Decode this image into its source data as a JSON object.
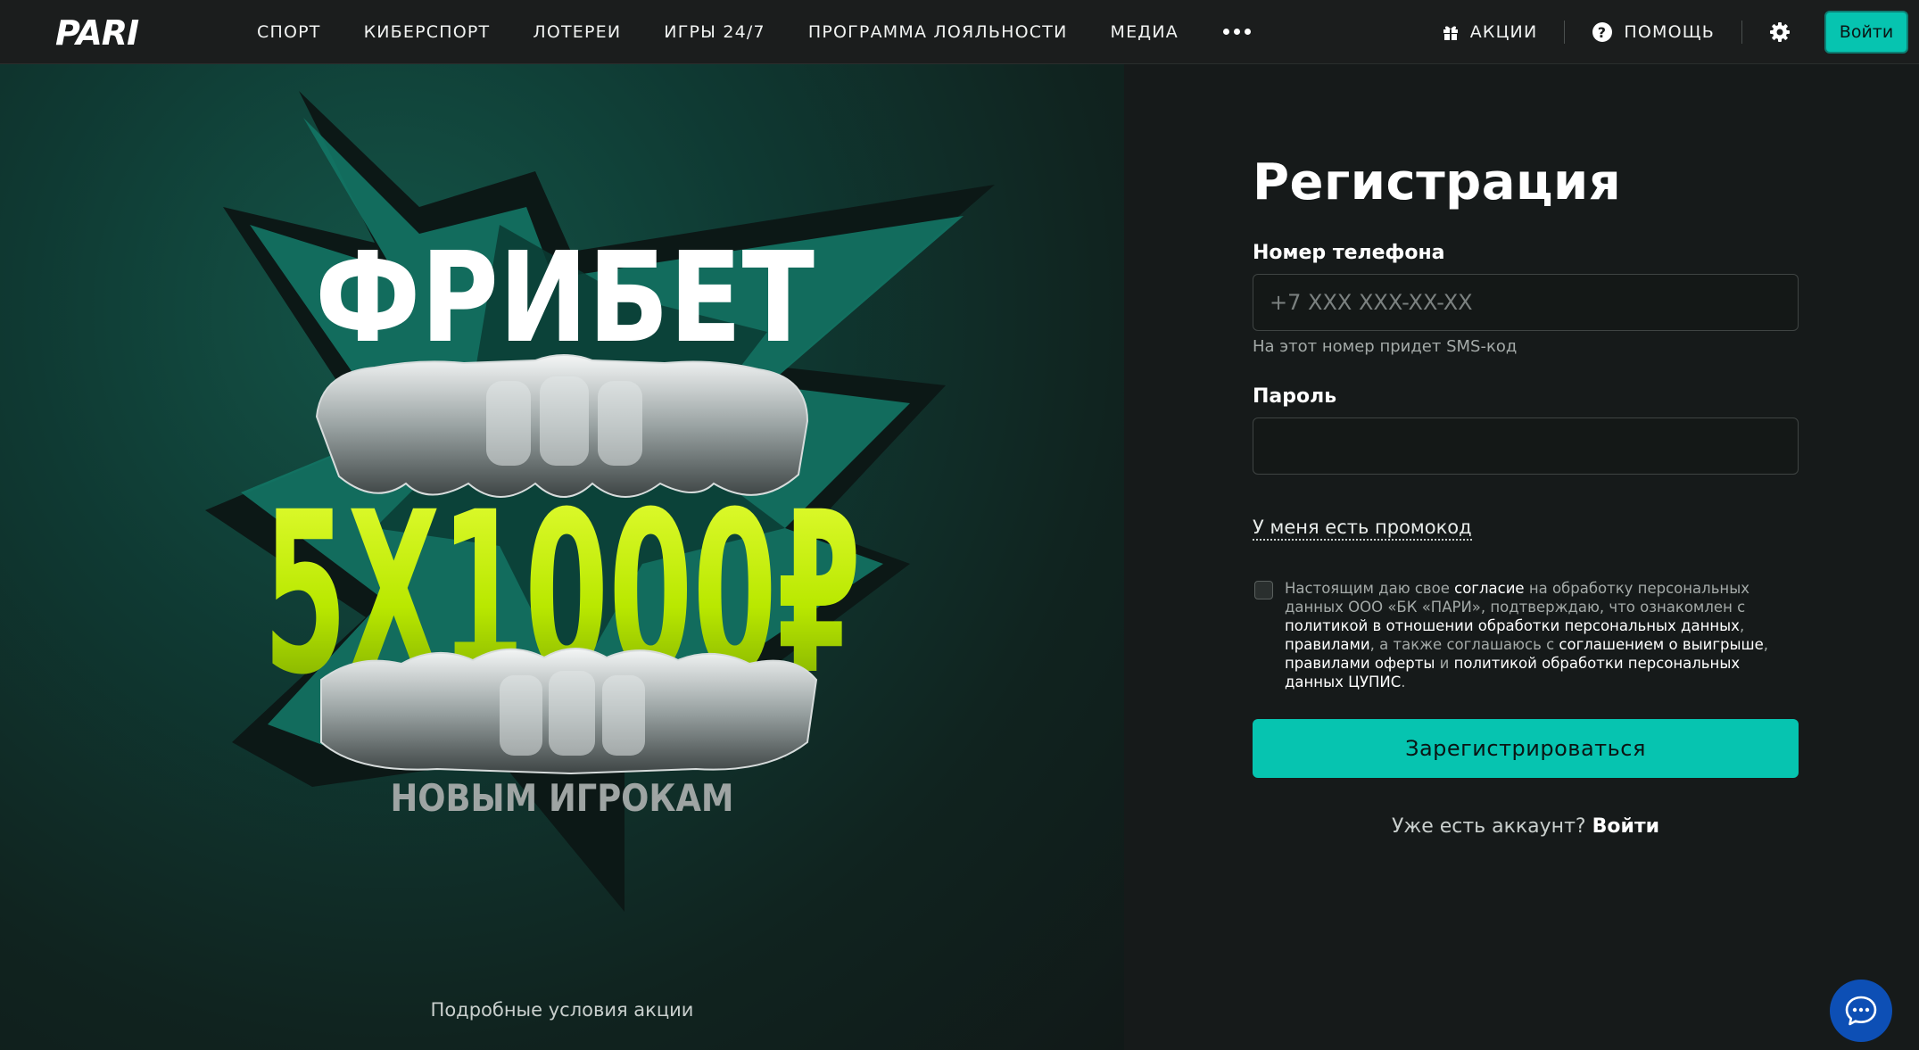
{
  "header": {
    "logo_text": "PARI",
    "nav": [
      "СПОРТ",
      "КИБЕРСПОРТ",
      "ЛОТЕРЕИ",
      "ИГРЫ 24/7",
      "ПРОГРАММА ЛОЯЛЬНОСТИ",
      "МЕДИА"
    ],
    "promos_label": "АКЦИИ",
    "help_label": "ПОМОЩЬ",
    "login_label": "Войти"
  },
  "promo": {
    "freebet_text": "ФРИБЕТ",
    "amount_text": "5X1000₽",
    "new_players_text": "НОВЫМ ИГРОКАМ",
    "terms_link": "Подробные условия акции"
  },
  "form": {
    "title": "Регистрация",
    "phone_label": "Номер телефона",
    "phone_placeholder": "+7 XXX XXX-XX-XX",
    "phone_hint": "На этот номер придет SMS-код",
    "password_label": "Пароль",
    "promo_code_link": "У меня есть промокод",
    "consent": {
      "t1": "Настоящим даю свое ",
      "l1": "согласие",
      "t2": " на обработку персональных данных ООО «БК «ПАРИ», подтверждаю, что ознакомлен с ",
      "l2": "политикой в отношении обработки персональных данных",
      "t3": ", ",
      "l3": "правилами",
      "t4": ", а также соглашаюсь с ",
      "l4": "соглашением о выигрыше",
      "t5": ", ",
      "l5": "правилами оферты",
      "t6": " и ",
      "l6": "политикой обработки персональных данных ЦУПИС",
      "t7": "."
    },
    "submit_label": "Зарегистрироваться",
    "already_text": "Уже есть аккаунт?",
    "login_link": "Войти"
  },
  "colors": {
    "accent": "#06c4b0",
    "lime": "#c6f000",
    "chat_button": "#0d4fb5",
    "header_bg": "#1b1d1d"
  },
  "icons": {
    "promos": "gift-icon",
    "help": "question-circle-icon",
    "settings": "gear-icon",
    "more": "more-dots-icon",
    "chat": "chat-bubble-icon"
  }
}
